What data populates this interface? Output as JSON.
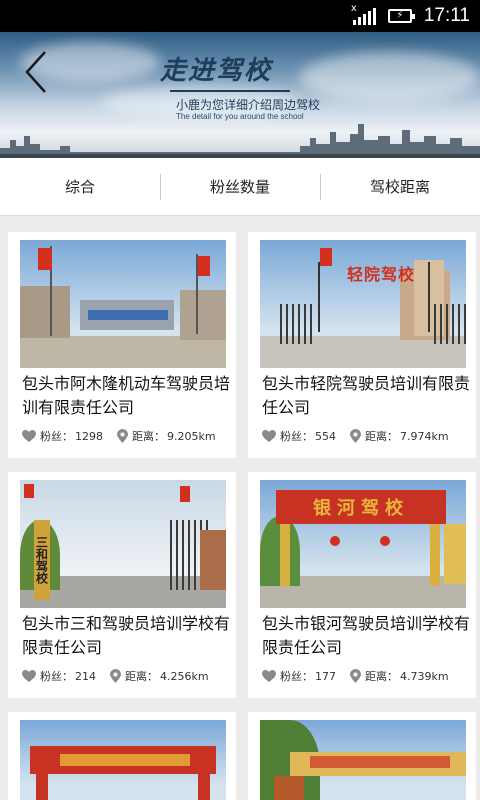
{
  "status_bar": {
    "time": "17:11"
  },
  "banner": {
    "title": "走进驾校",
    "subtitle": "小鹿为您详细介绍周边驾校",
    "subtitle_en": "The detail for you around the school"
  },
  "tabs": [
    {
      "label": "综合"
    },
    {
      "label": "粉丝数量"
    },
    {
      "label": "驾校距离"
    }
  ],
  "labels": {
    "fans": "粉丝：",
    "distance": "距离："
  },
  "schools": [
    {
      "name": "包头市阿木隆机动车驾驶员培训有限责任公司",
      "fans": "1298",
      "distance": "9.205km",
      "sign": ""
    },
    {
      "name": "包头市轻院驾驶员培训有限责任公司",
      "fans": "554",
      "distance": "7.974km",
      "sign": "轻院驾校"
    },
    {
      "name": "包头市三和驾驶员培训学校有限责任公司",
      "fans": "214",
      "distance": "4.256km",
      "sign": "三和驾校"
    },
    {
      "name": "包头市银河驾驶员培训学校有限责任公司",
      "fans": "177",
      "distance": "4.739km",
      "sign": "银河驾校"
    },
    {
      "name": "",
      "fans": "",
      "distance": "",
      "sign": ""
    },
    {
      "name": "",
      "fans": "",
      "distance": "",
      "sign": ""
    }
  ],
  "colors": {
    "accent_red": "#d22f1f",
    "sign_gold": "#e9b43a",
    "icon_gray": "#8a8a8a"
  }
}
